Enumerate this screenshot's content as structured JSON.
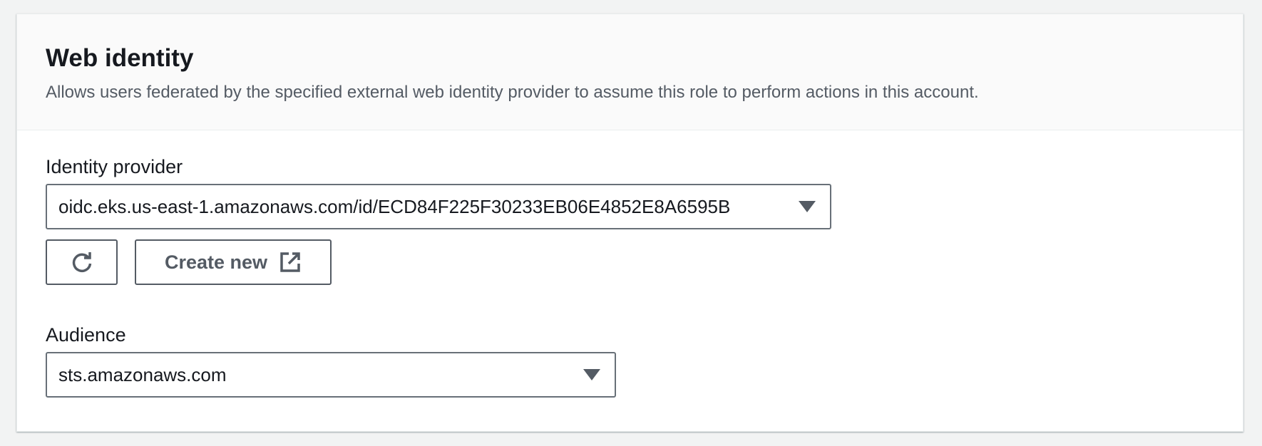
{
  "panel": {
    "title": "Web identity",
    "description": "Allows users federated by the specified external web identity provider to assume this role to perform actions in this account."
  },
  "identity_provider": {
    "label": "Identity provider",
    "value": "oidc.eks.us-east-1.amazonaws.com/id/ECD84F225F30233EB06E4852E8A6595B",
    "icon": "caret-down-icon"
  },
  "buttons": {
    "refresh_icon": "refresh-icon",
    "create_new_label": "Create new",
    "create_new_icon": "external-link-icon"
  },
  "audience": {
    "label": "Audience",
    "value": "sts.amazonaws.com",
    "icon": "caret-down-icon"
  },
  "colors": {
    "page_background": "#f2f3f3",
    "text_primary": "#16191f",
    "text_secondary": "#545b64",
    "border": "#687078"
  }
}
